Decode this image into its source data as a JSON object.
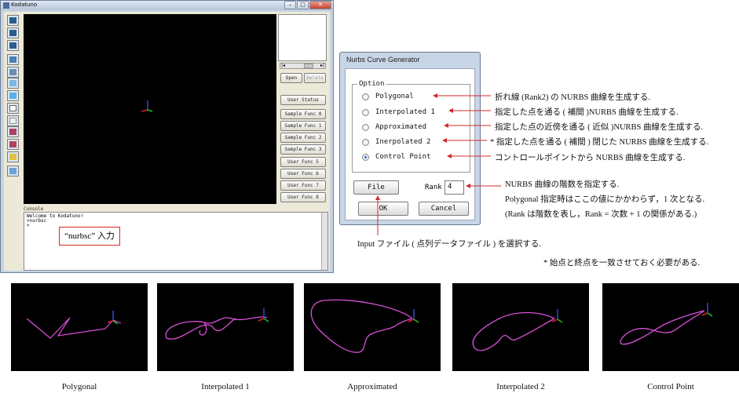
{
  "main_window": {
    "title": "Kodatuno",
    "window_buttons": [
      "–",
      "□",
      "✕"
    ],
    "list_buttons": {
      "open": "Open",
      "delete": "Delete"
    },
    "side_buttons": [
      "User Status",
      "Sample Func 0",
      "Sample Func 1",
      "Sample Func 2",
      "Sample Func 3",
      "User Func 5",
      "User Func 6",
      "User Func 7",
      "User Func 8"
    ],
    "console_label": "Console",
    "console_lines": [
      "Welcome to Kodatuno!",
      ">nurbsc",
      ">"
    ],
    "scroll_arrows": {
      "left": "|◂",
      "right": "▸|"
    },
    "annotation": "“nurbsc” 入力",
    "toolbar_icons": [
      "view-front-icon",
      "view-side-icon",
      "view-top-icon",
      "view-axo-icon",
      "view-screen-icon",
      "solid-icon",
      "shade-icon",
      "wire-icon",
      "hidden-icon",
      "split-icon",
      "split2-icon",
      "edit-icon",
      "color-icon"
    ]
  },
  "dialog": {
    "title": "Nurbs Curve Generator",
    "option_legend": "Option",
    "options": [
      {
        "label": "Polygonal",
        "selected": false
      },
      {
        "label": "Interpolated 1",
        "selected": false
      },
      {
        "label": "Approximated",
        "selected": false
      },
      {
        "label": "Inerpolated 2",
        "selected": false
      },
      {
        "label": "Control Point",
        "selected": true
      }
    ],
    "file_button": "File",
    "rank_label": "Rank",
    "rank_value": "4",
    "ok_button": "OK",
    "cancel_button": "Cancel"
  },
  "annotations": {
    "opt1": "折れ線 (Rank2) の NURBS 曲線を生成する.",
    "opt2": "指定した点を通る ( 補間 )NURBS 曲線を生成する.",
    "opt3": "指定した点の近傍を通る ( 近似 )NURBS 曲線を生成する.",
    "opt4": "* 指定した点を通る ( 補間 ) 閉じた NURBS 曲線を生成する.",
    "opt5": "コントロールポイントから NURBS 曲線を生成する.",
    "rank1": "NURBS 曲線の階数を指定する.",
    "rank2": "Polygonal 指定時はここの値にかかわらず，1 次となる.",
    "rank3": "(Rank は階数を表し，Rank = 次数 + 1 の関係がある.)",
    "file": "Input ファイル ( 点列データファイル ) を選択する.",
    "note": "* 始点と終点を一致させておく必要がある."
  },
  "results": [
    {
      "caption": "Polygonal"
    },
    {
      "caption": "Interpolated 1"
    },
    {
      "caption": "Approximated"
    },
    {
      "caption": "Interpolated 2"
    },
    {
      "caption": "Control Point"
    }
  ],
  "colors": {
    "annotation_red": "#d12a2a",
    "curve": "#d84fd8",
    "viewport": "#000000",
    "axis_x": "#e02020",
    "axis_y": "#22c022",
    "axis_z": "#2a4ad8"
  }
}
